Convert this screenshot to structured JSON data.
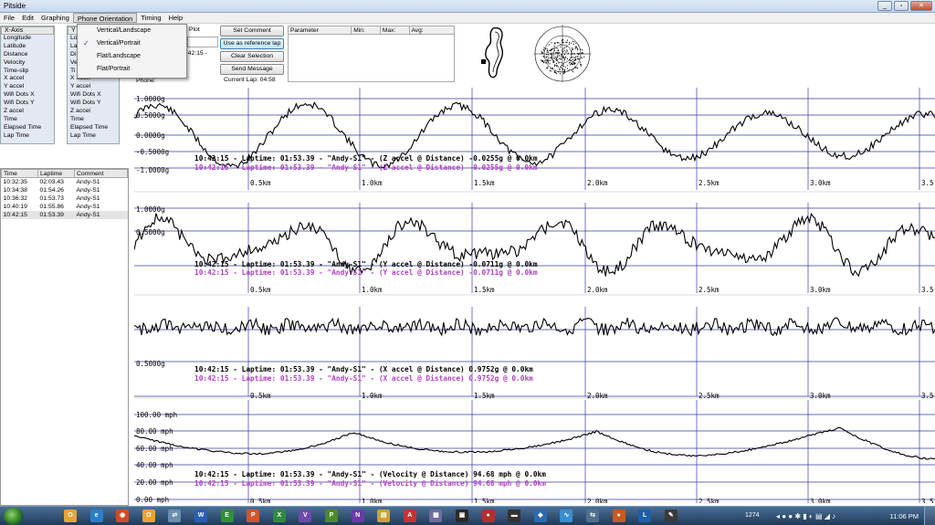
{
  "window": {
    "title": "Pitside"
  },
  "menu": [
    "File",
    "Edit",
    "Graphing",
    "Phone Orientation",
    "Timing",
    "Help"
  ],
  "phone_orientation_menu": {
    "items": [
      "Vertical/Landscape",
      "Vertical/Portrait",
      "Flat/Landscape",
      "Flat/Portrait"
    ],
    "checked": "Vertical/Portrait"
  },
  "x_axis": {
    "header": "X-Axis",
    "items": [
      "Longitude",
      "Latitude",
      "Distance",
      "Velocity",
      "Time-slip",
      "X accel",
      "Y accel",
      "Wifi Dots X",
      "Wifi Dots Y",
      "Z accel",
      "Time",
      "Elapsed Time",
      "Lap Time"
    ]
  },
  "y_axis": {
    "header": "Y",
    "items_partial": [
      "Lo",
      "La",
      "Di",
      "Ve",
      "Ti"
    ],
    "items": [
      "X accel",
      "Y accel",
      "Wifi Dots X",
      "Wifi Dots Y",
      "Z accel",
      "Time",
      "Elapsed Time",
      "Lap Time"
    ]
  },
  "plot_label": "Plot",
  "time_partial": "2:42:15 -",
  "phone_label": "Phone:",
  "buttons": {
    "set_comment": "Set Comment",
    "use_reference": "Use as reference lap",
    "clear_selection": "Clear Selection",
    "send_message": "Send Message"
  },
  "current_lap": "Current Lap: 04:58",
  "param_table": {
    "columns": [
      "Parameter",
      "Min:",
      "Max:",
      "Avg:"
    ]
  },
  "laps": {
    "columns": [
      "Time",
      "Laptime",
      "Comment"
    ],
    "rows": [
      [
        "10:32:35",
        "02:03.43",
        "Andy-S1"
      ],
      [
        "10:34:38",
        "01:54.26",
        "Andy-S1"
      ],
      [
        "10:36:32",
        "01:53.73",
        "Andy-S1"
      ],
      [
        "10:40:19",
        "01:55.86",
        "Andy-S1"
      ],
      [
        "10:42:15",
        "01:53.39",
        "Andy-S1"
      ]
    ],
    "selected_index": 4
  },
  "graphs": [
    {
      "ylabels": [
        "1.0000g",
        "0.5000g",
        "0.0000g",
        "-0.5000g",
        "-1.0000g"
      ],
      "line1": "10:42:15 - Laptime: 01:53.39 - \"Andy-S1\" - (Z accel @ Distance) -0.0255g @  0.0km",
      "line2": "10:42:15 - Laptime: 01:53.39 - \"Andy-S1\" - (Z accel @ Distance) -0.0255g @  0.0km"
    },
    {
      "ylabels": [
        "1.0000g",
        "0.5000g"
      ],
      "line1": "10:42:15 - Laptime: 01:53.39 - \"Andy-S1\" - (Y accel @ Distance) -0.0711g @  0.0km",
      "line2": "10:42:15 - Laptime: 01:53.39 - \"Andy-S1\" - (Y accel @ Distance) -0.0711g @  0.0km"
    },
    {
      "ylabels": [
        "0.5000g"
      ],
      "line1": "10:42:15 - Laptime: 01:53.39 - \"Andy-S1\" - (X accel @ Distance) 0.9752g @  0.0km",
      "line2": "10:42:15 - Laptime: 01:53.39 - \"Andy-S1\" - (X accel @ Distance) 0.9752g @  0.0km"
    },
    {
      "ylabels": [
        "100.00 mph",
        "80.00 mph",
        "60.00 mph",
        "40.00 mph",
        "20.00 mph",
        "0.00 mph"
      ],
      "line1": "10:42:15 - Laptime: 01:53.39 - \"Andy-S1\" - (Velocity @ Distance) 94.68 mph @  0.0km",
      "line2": "10:42:15 - Laptime: 01:53.39 - \"Andy-S1\" - (Velocity @ Distance) 94.68 mph @  0.0km"
    }
  ],
  "xticks": [
    "0.5km",
    "1.0km",
    "1.5km",
    "2.0km",
    "2.5km",
    "3.0km",
    "3.5"
  ],
  "colors": {
    "trace": "#000000",
    "reference": "#b040c0",
    "grid": "#3a3aa0"
  },
  "taskbar": {
    "clock": "11:06 PM",
    "tray_number": "1274",
    "icons": [
      "O",
      "e",
      "◉",
      "O",
      "⇄",
      "W",
      "E",
      "P",
      "X",
      "V",
      "P",
      "N",
      "▤",
      "A",
      "▦",
      "▣",
      "●",
      "▬",
      "◆",
      "∿",
      "⇆",
      "●",
      "L",
      "✎"
    ]
  }
}
